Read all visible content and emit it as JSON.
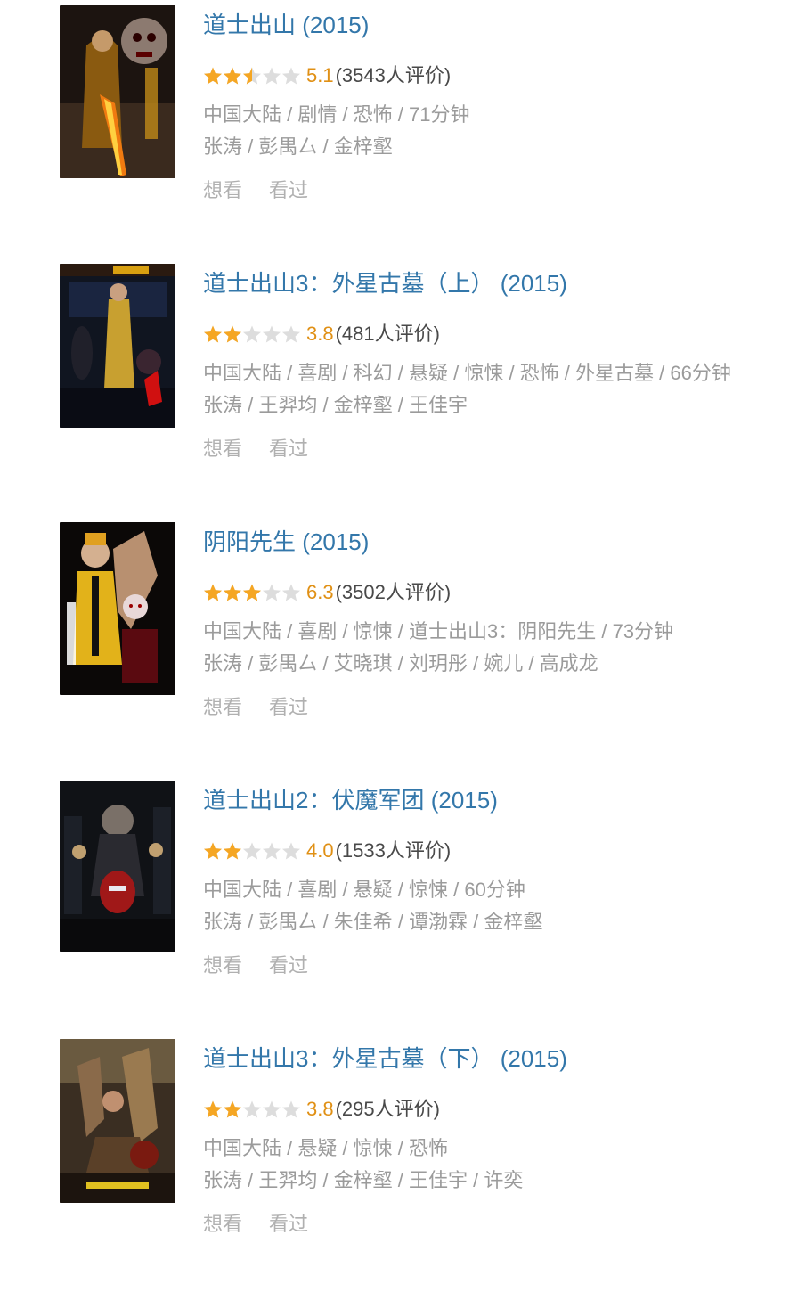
{
  "colors": {
    "title": "#3377aa",
    "score": "#e09015",
    "meta": "#9b9b9b",
    "star_on": "#f5a623",
    "star_off": "#dddddd"
  },
  "movies": [
    {
      "title": "道士出山",
      "year": "(2015)",
      "stars": 2.5,
      "score": "5.1",
      "count": "(3543人评价)",
      "meta": "中国大陆 / 剧情 / 恐怖 / 71分钟",
      "cast": "张涛 / 彭禺厶 / 金梓壑",
      "want": "想看",
      "seen": "看过"
    },
    {
      "title": "道士出山3：外星古墓（上）",
      "year": "(2015)",
      "stars": 2,
      "score": "3.8",
      "count": "(481人评价)",
      "meta": "中国大陆 / 喜剧 / 科幻 / 悬疑 / 惊悚 / 恐怖 / 外星古墓 / 66分钟",
      "cast": "张涛 / 王羿均 / 金梓壑 / 王佳宇",
      "want": "想看",
      "seen": "看过"
    },
    {
      "title": "阴阳先生",
      "year": "(2015)",
      "stars": 3,
      "score": "6.3",
      "count": "(3502人评价)",
      "meta": "中国大陆 / 喜剧 / 惊悚 / 道士出山3：阴阳先生 / 73分钟",
      "cast": "张涛 / 彭禺厶 / 艾晓琪 / 刘玥彤 / 婉儿 / 高成龙",
      "want": "想看",
      "seen": "看过"
    },
    {
      "title": "道士出山2：伏魔军团",
      "year": "(2015)",
      "stars": 2,
      "score": "4.0",
      "count": "(1533人评价)",
      "meta": "中国大陆 / 喜剧 / 悬疑 / 惊悚 / 60分钟",
      "cast": "张涛 / 彭禺厶 / 朱佳希 / 谭渤霖 / 金梓壑",
      "want": "想看",
      "seen": "看过"
    },
    {
      "title": "道士出山3：外星古墓（下）",
      "year": "(2015)",
      "stars": 2,
      "score": "3.8",
      "count": "(295人评价)",
      "meta": "中国大陆 / 悬疑 / 惊悚 / 恐怖",
      "cast": "张涛 / 王羿均 / 金梓壑 / 王佳宇 / 许奕",
      "want": "想看",
      "seen": "看过"
    }
  ]
}
